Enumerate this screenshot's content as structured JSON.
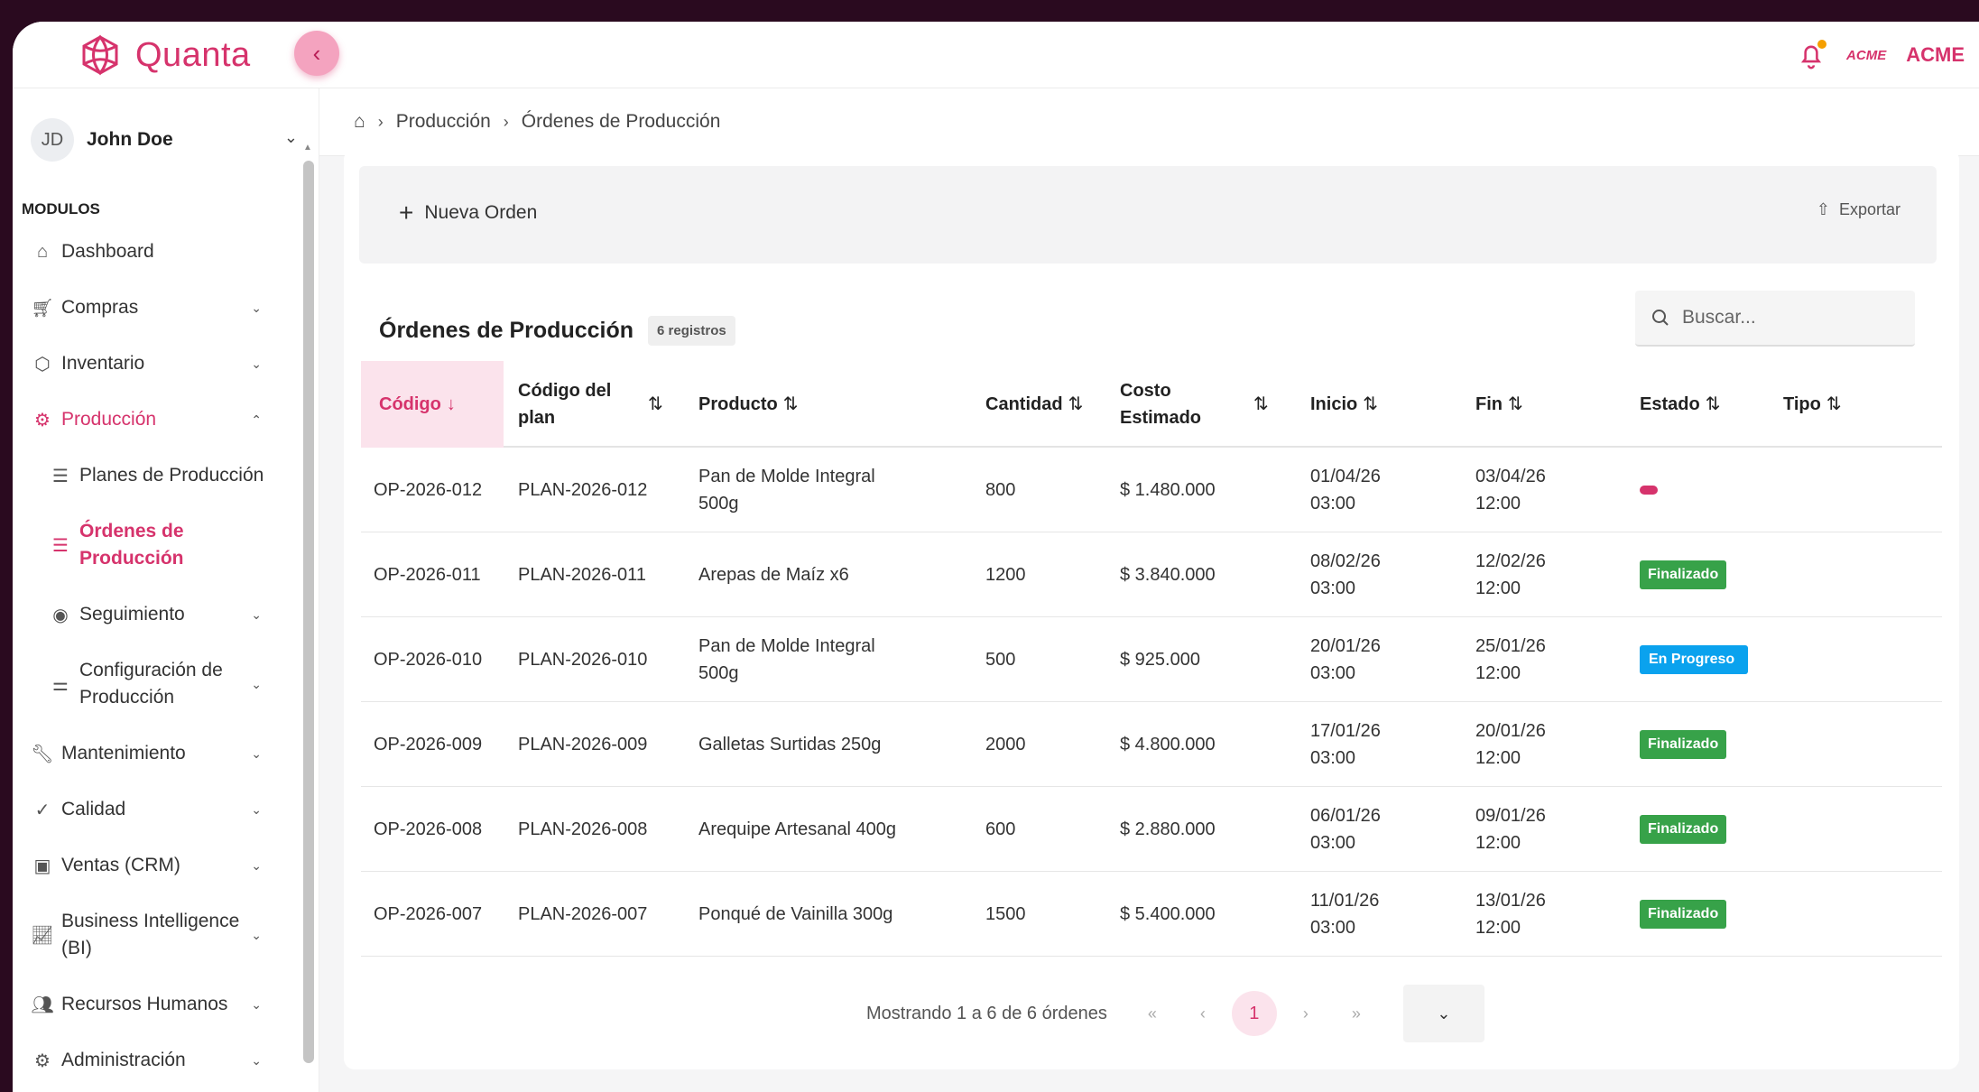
{
  "app": {
    "brand": "Quanta",
    "collapse_icon": "chevron-left-icon",
    "company_logo": "ACME",
    "company_name": "ACME"
  },
  "user": {
    "initials": "JD",
    "name": "John Doe"
  },
  "sidebar": {
    "section_label": "MODULOS",
    "items": [
      {
        "label": "Dashboard",
        "icon": "home-icon",
        "has_children": false
      },
      {
        "label": "Compras",
        "icon": "cart-icon",
        "has_children": true
      },
      {
        "label": "Inventario",
        "icon": "box-icon",
        "has_children": true
      },
      {
        "label": "Producción",
        "icon": "gear-icon",
        "has_children": true,
        "expanded": true
      },
      {
        "label": "Planes de Producción",
        "icon": "list-icon",
        "sub": true
      },
      {
        "label": "Órdenes de Producción",
        "icon": "list-icon",
        "sub": true,
        "active": true
      },
      {
        "label": "Seguimiento",
        "icon": "eye-icon",
        "sub": true,
        "has_children": true
      },
      {
        "label": "Configuración de Producción",
        "icon": "sliders-icon",
        "sub": true,
        "has_children": true
      },
      {
        "label": "Mantenimiento",
        "icon": "wrench-icon",
        "has_children": true
      },
      {
        "label": "Calidad",
        "icon": "check-circle-icon",
        "has_children": true
      },
      {
        "label": "Ventas (CRM)",
        "icon": "id-card-icon",
        "has_children": true
      },
      {
        "label": "Business Intelligence (BI)",
        "icon": "chart-icon",
        "has_children": true
      },
      {
        "label": "Recursos Humanos",
        "icon": "users-icon",
        "has_children": true
      },
      {
        "label": "Administración",
        "icon": "settings-icon",
        "has_children": true
      }
    ]
  },
  "breadcrumb": {
    "home_icon": "home-icon",
    "items": [
      "Producción",
      "Órdenes de Producción"
    ]
  },
  "toolbar": {
    "new_label": "Nueva Orden",
    "export_label": "Exportar"
  },
  "table": {
    "title": "Órdenes de Producción",
    "count_label": "6 registros",
    "search_placeholder": "Buscar...",
    "columns": [
      "Código",
      "Código del plan",
      "Producto",
      "Cantidad",
      "Costo Estimado",
      "Inicio",
      "Fin",
      "Estado",
      "Tipo"
    ],
    "rows": [
      {
        "codigo": "OP-2026-012",
        "plan": "PLAN-2026-012",
        "producto": "Pan de Molde Integral 500g",
        "cantidad": "800",
        "costo": "$ 1.480.000",
        "inicio": "01/04/26 03:00",
        "fin": "03/04/26 12:00",
        "estado": "",
        "estado_color": "#d6336c"
      },
      {
        "codigo": "OP-2026-011",
        "plan": "PLAN-2026-011",
        "producto": "Arepas de Maíz x6",
        "cantidad": "1200",
        "costo": "$ 3.840.000",
        "inicio": "08/02/26 03:00",
        "fin": "12/02/26 12:00",
        "estado": "Finalizado",
        "estado_color": "#37a249"
      },
      {
        "codigo": "OP-2026-010",
        "plan": "PLAN-2026-010",
        "producto": "Pan de Molde Integral 500g",
        "cantidad": "500",
        "costo": "$ 925.000",
        "inicio": "20/01/26 03:00",
        "fin": "25/01/26 12:00",
        "estado": "En Progreso",
        "estado_color": "#0aa2ee"
      },
      {
        "codigo": "OP-2026-009",
        "plan": "PLAN-2026-009",
        "producto": "Galletas Surtidas 250g",
        "cantidad": "2000",
        "costo": "$ 4.800.000",
        "inicio": "17/01/26 03:00",
        "fin": "20/01/26 12:00",
        "estado": "Finalizado",
        "estado_color": "#37a249"
      },
      {
        "codigo": "OP-2026-008",
        "plan": "PLAN-2026-008",
        "producto": "Arequipe Artesanal 400g",
        "cantidad": "600",
        "costo": "$ 2.880.000",
        "inicio": "06/01/26 03:00",
        "fin": "09/01/26 12:00",
        "estado": "Finalizado",
        "estado_color": "#37a249"
      },
      {
        "codigo": "OP-2026-007",
        "plan": "PLAN-2026-007",
        "producto": "Ponqué de Vainilla 300g",
        "cantidad": "1500",
        "costo": "$ 5.400.000",
        "inicio": "11/01/26 03:00",
        "fin": "13/01/26 12:00",
        "estado": "Finalizado",
        "estado_color": "#37a249"
      }
    ]
  },
  "pagination": {
    "info": "Mostrando 1 a 6 de 6 órdenes",
    "current_page": "1",
    "first": "«",
    "prev": "‹",
    "next": "›",
    "last": "»"
  },
  "colors": {
    "accent": "#d6336c",
    "finalizado": "#37a249",
    "en_progreso": "#0aa2ee"
  }
}
